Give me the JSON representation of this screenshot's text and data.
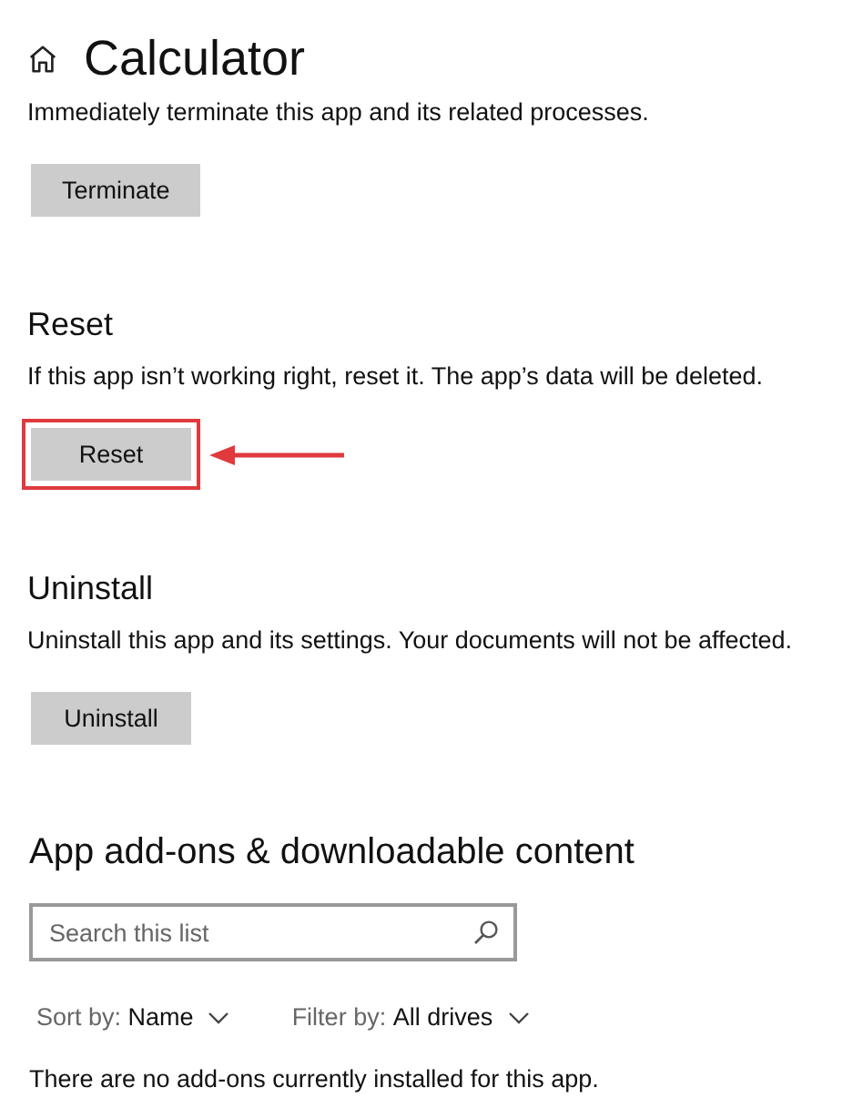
{
  "header": {
    "title": "Calculator"
  },
  "sections": [
    {
      "description": "Immediately terminate this app and its related processes.",
      "button": {
        "label": "Terminate",
        "highlighted": false
      }
    },
    {
      "heading": "Reset",
      "description": "If this app isn’t working right, reset it. The app’s data will be deleted.",
      "button": {
        "label": "Reset",
        "highlighted": true
      }
    },
    {
      "heading": "Uninstall",
      "description": "Uninstall this app and its settings. Your documents will not be affected.",
      "button": {
        "label": "Uninstall",
        "highlighted": false
      }
    }
  ],
  "addons": {
    "heading": "App add-ons & downloadable content",
    "search": {
      "placeholder": "Search this list"
    },
    "sort": {
      "label": "Sort by:",
      "value": "Name"
    },
    "filter": {
      "label": "Filter by:",
      "value": "All drives"
    },
    "empty_message": "There are no add-ons currently installed for this app."
  }
}
